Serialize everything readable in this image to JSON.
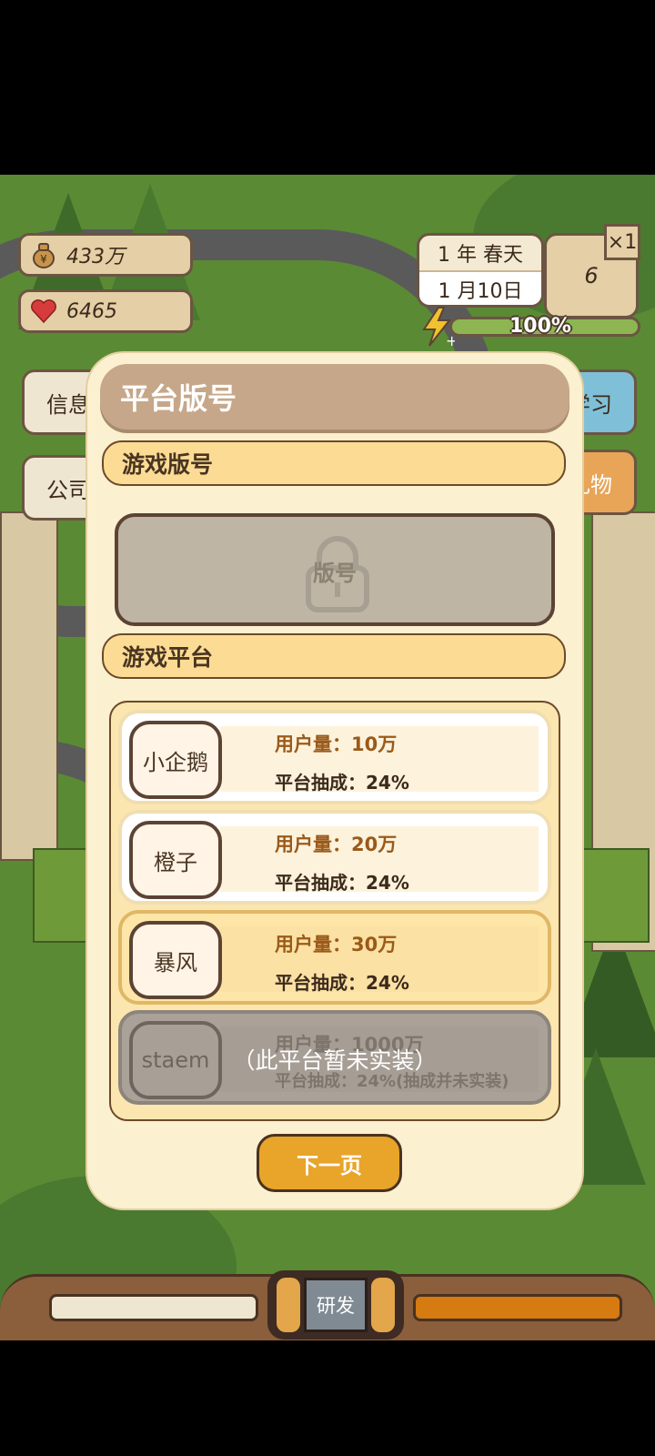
{
  "hud": {
    "money": "433万",
    "fans": "6465",
    "date_year": "1 年 春天",
    "date_day": "1 月10日",
    "calendar_day": "6",
    "speed": "×1",
    "energy_percent": 1.0,
    "energy_text": "100%",
    "left_buttons": [
      "信息",
      "公司"
    ],
    "right_buttons": [
      "学习",
      "礼物"
    ]
  },
  "modal": {
    "title": "平台版号",
    "section_license": "游戏版号",
    "license_placeholder": "版号",
    "section_platform": "游戏平台",
    "platforms": [
      {
        "name": "小企鹅",
        "users": "用户量：10万",
        "commission": "平台抽成：24%",
        "state": "normal"
      },
      {
        "name": "橙子",
        "users": "用户量：20万",
        "commission": "平台抽成：24%",
        "state": "normal"
      },
      {
        "name": "暴风",
        "users": "用户量：30万",
        "commission": "平台抽成：24%",
        "state": "selected"
      },
      {
        "name": "staem",
        "users": "用户量：1000万",
        "commission": "平台抽成：24%(抽成并未实装)",
        "state": "locked",
        "note": "（此平台暂未实装）"
      }
    ],
    "next_button": "下一页"
  },
  "bottom": {
    "console_label": "研发"
  },
  "colors": {
    "modal_bg": "#fbf0cf",
    "title_bar": "#c6a789",
    "section_header": "#fcdc94",
    "accent_orange": "#e8a52a",
    "selected_bg": "#fce6b0"
  }
}
